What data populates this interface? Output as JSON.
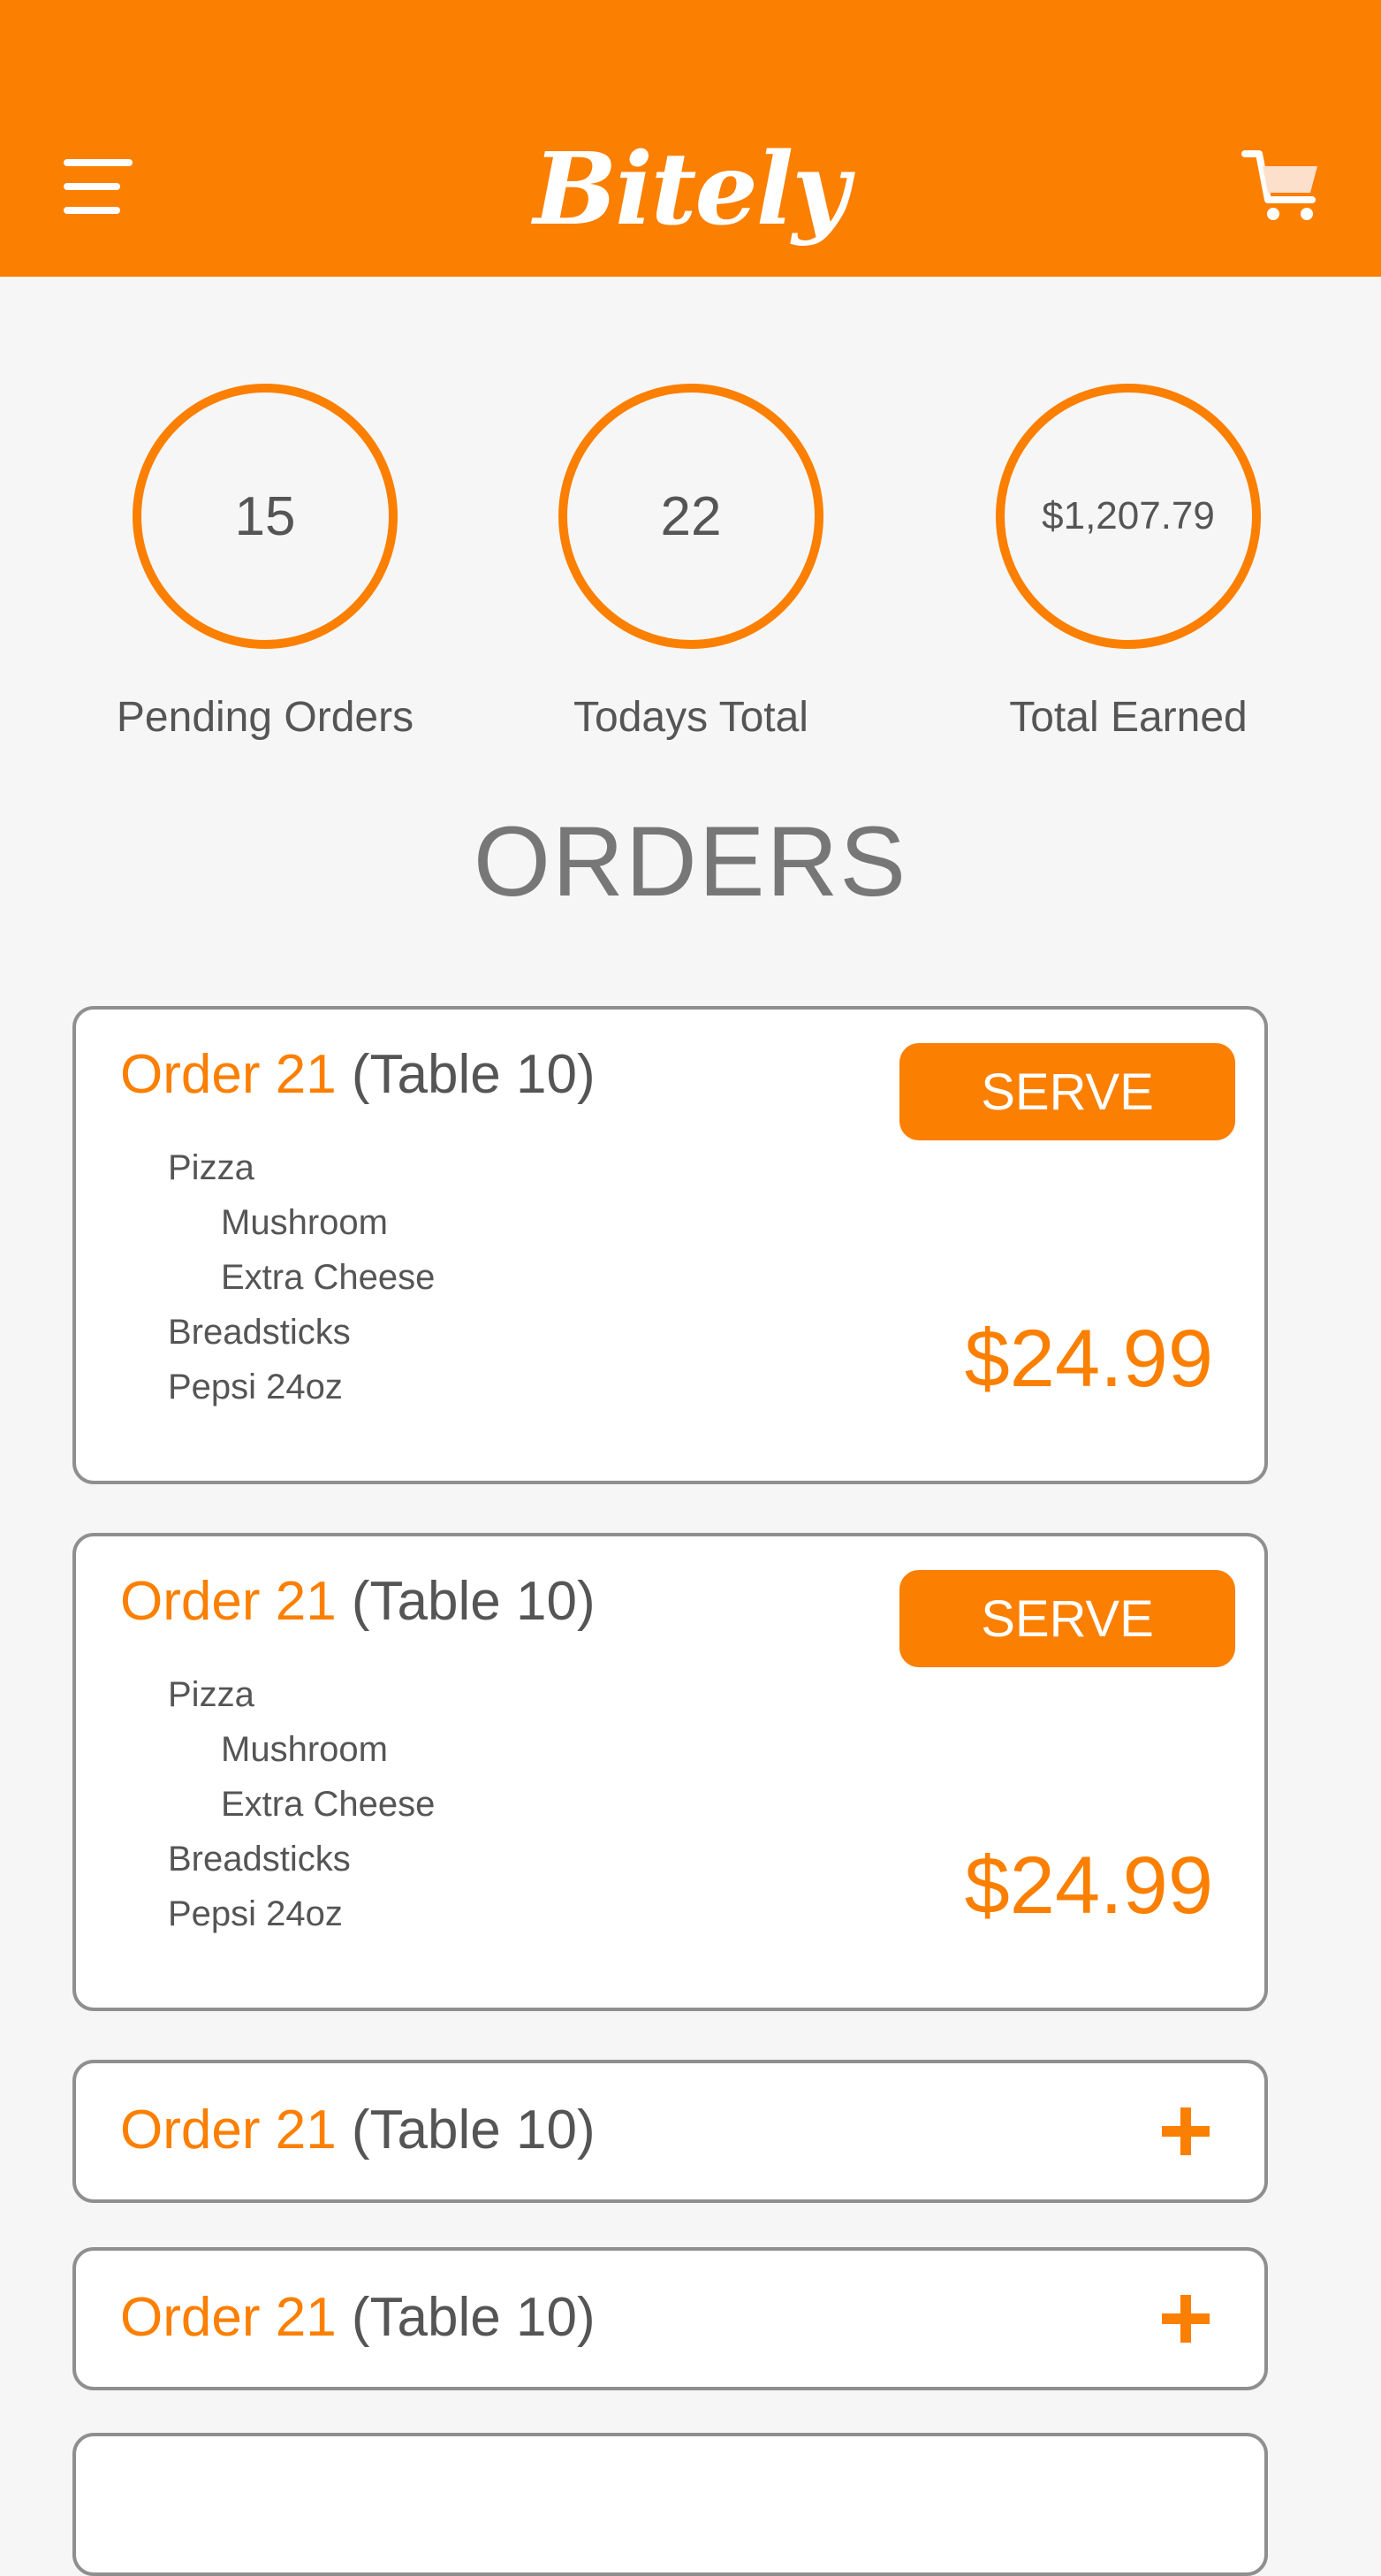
{
  "header": {
    "logo_text": "Bitely",
    "menu_icon": "hamburger-menu-icon",
    "cart_icon": "shopping-cart-icon",
    "background_color": "#fb7f00"
  },
  "stats": [
    {
      "value": "15",
      "label": "Pending Orders"
    },
    {
      "value": "22",
      "label": "Todays Total"
    },
    {
      "value": "$1,207.79",
      "label": "Total Earned"
    }
  ],
  "orders_title": "ORDERS",
  "orders": [
    {
      "order_label": "Order 21",
      "table_label": "(Table 10)",
      "serve_label": "SERVE",
      "items": [
        "Pizza",
        "Mushroom",
        "Extra Cheese",
        "Breadsticks",
        "Pepsi 24oz"
      ],
      "price": "$24.99"
    },
    {
      "order_label": "Order 21",
      "table_label": "(Table 10)",
      "serve_label": "SERVE",
      "items": [
        "Pizza",
        "Mushroom",
        "Extra Cheese",
        "Breadsticks",
        "Pepsi 24oz"
      ],
      "price": "$24.99"
    },
    {
      "order_label": "Order 21",
      "table_label": "(Table 10)",
      "expand_icon": "plus-icon"
    },
    {
      "order_label": "Order 21",
      "table_label": "(Table 10)",
      "expand_icon": "plus-icon"
    }
  ],
  "colors": {
    "accent": "#fb7f00",
    "text": "#555555",
    "card_border": "#8f8f8f",
    "background": "#f6f6f6"
  }
}
